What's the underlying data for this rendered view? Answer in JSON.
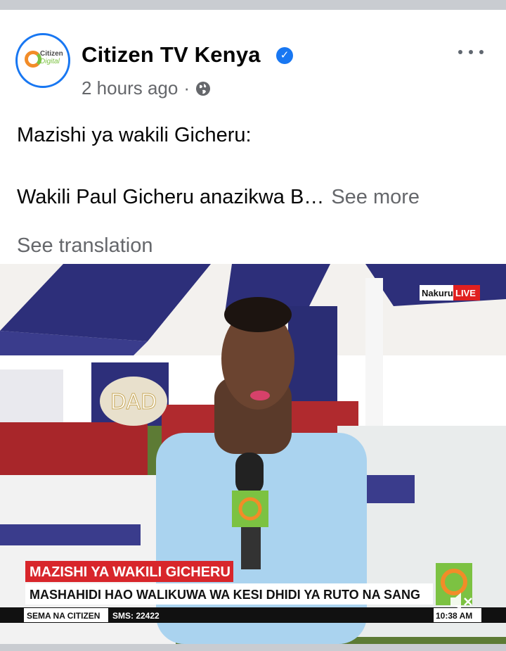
{
  "post": {
    "page_name": "Citizen TV Kenya",
    "verified_mark": "✓",
    "timestamp": "2 hours ago",
    "separator": "·",
    "privacy_icon": "globe-icon",
    "more_icon": "more-horizontal-icon",
    "avatar_logo_name": "Citizen",
    "avatar_logo_sub": "Digital",
    "text_line1": "Mazishi ya wakili Gicheru:",
    "text_line2": "Wakili Paul Gicheru anazikwa B…",
    "see_more": "See more",
    "see_translation": "See translation"
  },
  "video": {
    "location_tag": "Nakuru",
    "live_tag": "LIVE",
    "headline": "MAZISHI YA WAKILI GICHERU",
    "subheadline": "MASHAHIDI HAO WALIKUWA WA KESI DHIDI YA RUTO NA SANG",
    "ticker_label": "SEMA NA CITIZEN",
    "ticker_sms": "SMS: 22422",
    "clock": "10:38 AM",
    "wreath_text": "DAD",
    "mute_icon": "speaker-muted-icon"
  },
  "colors": {
    "verified_blue": "#1877f2",
    "meta_gray": "#65676b",
    "live_red": "#e02020",
    "headline_red": "#d8262b",
    "citizen_orange": "#f28c28",
    "citizen_green": "#7cc242"
  }
}
